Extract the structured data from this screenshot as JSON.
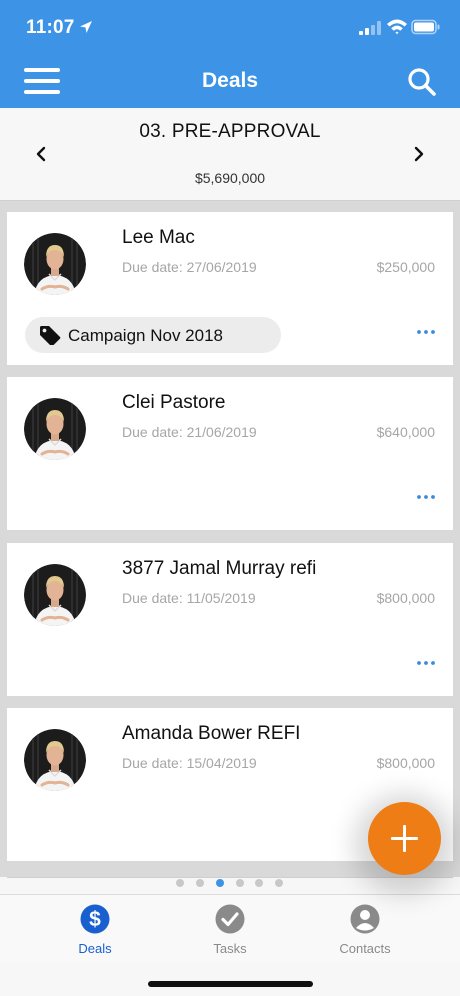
{
  "status_bar": {
    "time": "11:07"
  },
  "nav": {
    "title": "Deals"
  },
  "stage": {
    "name": "03. PRE-APPROVAL",
    "total": "$5,690,000"
  },
  "deals": [
    {
      "name": "Lee Mac",
      "due": "Due date: 27/06/2019",
      "amount": "$250,000",
      "tag": "Campaign Nov 2018"
    },
    {
      "name": "Clei Pastore",
      "due": "Due date: 21/06/2019",
      "amount": "$640,000"
    },
    {
      "name": "3877 Jamal Murray refi",
      "due": "Due date: 11/05/2019",
      "amount": "$800,000"
    },
    {
      "name": "Amanda Bower REFI",
      "due": "Due date: 15/04/2019",
      "amount": "$800,000"
    }
  ],
  "pager": {
    "count": 6,
    "active_index": 2
  },
  "tabs": [
    {
      "label": "Deals",
      "icon": "dollar-circle-icon",
      "active": true
    },
    {
      "label": "Tasks",
      "icon": "check-circle-icon",
      "active": false
    },
    {
      "label": "Contacts",
      "icon": "person-circle-icon",
      "active": false
    }
  ],
  "colors": {
    "primary": "#3d93e6",
    "fab": "#ef7d16",
    "active_tab": "#1a5fd0"
  }
}
